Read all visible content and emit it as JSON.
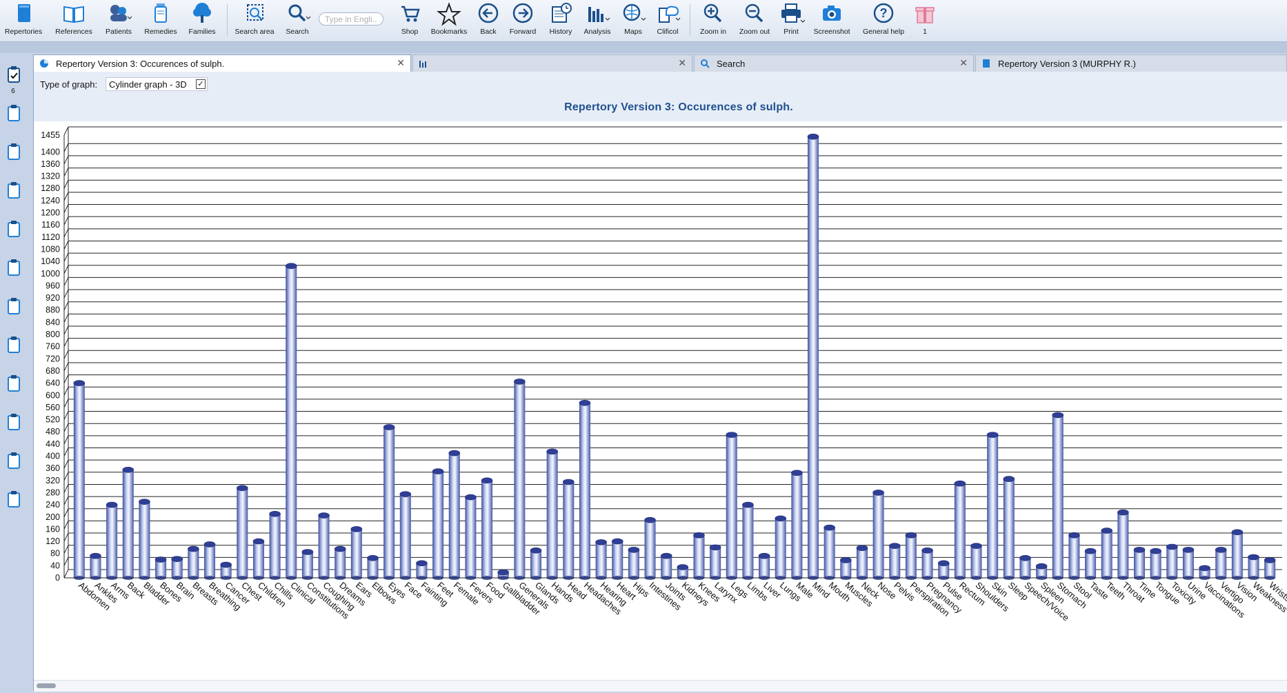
{
  "toolbar": {
    "repertories": "Repertories",
    "references": "References",
    "patients": "Patients",
    "remedies": "Remedies",
    "families": "Families",
    "search_area": "Search area",
    "search": "Search",
    "search_placeholder": "Type in Engli...",
    "shop": "Shop",
    "bookmarks": "Bookmarks",
    "back": "Back",
    "forward": "Forward",
    "history": "History",
    "analysis": "Analysis",
    "maps": "Maps",
    "clificol": "Clificol",
    "zoom_in": "Zoom in",
    "zoom_out": "Zoom out",
    "print": "Print",
    "screenshot": "Screenshot",
    "general_help": "General help",
    "gift_count": "1"
  },
  "sidebar": {
    "clipboard_count": "6"
  },
  "tabs": [
    {
      "label": "Repertory Version 3: Occurences of sulph."
    },
    {
      "label": ""
    },
    {
      "label": "Search"
    },
    {
      "label": "Repertory Version 3 (MURPHY R.)"
    }
  ],
  "panel": {
    "graph_type_label": "Type of graph:",
    "graph_type_value": "Cylinder graph - 3D"
  },
  "chart_data": {
    "type": "bar",
    "title": "Repertory Version 3: Occurences of sulph.",
    "xlabel": "",
    "ylabel": "",
    "ylim": [
      0,
      1455
    ],
    "yticks": [
      0,
      40,
      80,
      120,
      160,
      200,
      240,
      280,
      320,
      360,
      400,
      440,
      480,
      520,
      560,
      600,
      640,
      680,
      720,
      760,
      800,
      840,
      880,
      920,
      960,
      1000,
      1040,
      1080,
      1120,
      1160,
      1200,
      1240,
      1280,
      1320,
      1360,
      1400,
      1455
    ],
    "grid": true,
    "categories": [
      "Abdomen",
      "Ankles",
      "Arms",
      "Back",
      "Bladder",
      "Bones",
      "Brain",
      "Breasts",
      "Breathing",
      "Cancer",
      "Chest",
      "Children",
      "Chills",
      "Clinical",
      "Constitutions",
      "Coughing",
      "Dreams",
      "Ears",
      "Elbows",
      "Eyes",
      "Face",
      "Fainting",
      "Feet",
      "Female",
      "Fevers",
      "Food",
      "Gallbladder",
      "Generals",
      "Glands",
      "Hands",
      "Head",
      "Headaches",
      "Hearing",
      "Heart",
      "Hips",
      "Intestines",
      "Joints",
      "Kidneys",
      "Knees",
      "Larynx",
      "Legs",
      "Limbs",
      "Liver",
      "Lungs",
      "Male",
      "Mind",
      "Mouth",
      "Muscles",
      "Neck",
      "Nose",
      "Pelvis",
      "Perspiration",
      "Pregnancy",
      "Pulse",
      "Rectum",
      "Shoulders",
      "Skin",
      "Sleep",
      "Speech/Voice",
      "Spleen",
      "Stomach",
      "Stool",
      "Taste",
      "Teeth",
      "Throat",
      "Time",
      "Tongue",
      "Toxicity",
      "Urine",
      "Vaccinations",
      "Vertigo",
      "Vision",
      "Weakness",
      "Wrists"
    ],
    "values": [
      640,
      72,
      240,
      355,
      250,
      60,
      62,
      95,
      110,
      43,
      295,
      120,
      210,
      1025,
      85,
      205,
      95,
      160,
      65,
      495,
      275,
      48,
      350,
      410,
      265,
      320,
      18,
      645,
      90,
      415,
      315,
      575,
      117,
      120,
      92,
      190,
      72,
      35,
      140,
      100,
      470,
      240,
      72,
      195,
      345,
      1450,
      165,
      58,
      98,
      280,
      105,
      140,
      90,
      48,
      310,
      105,
      470,
      325,
      65,
      38,
      535,
      140,
      88,
      155,
      215,
      92,
      88,
      102,
      92,
      32,
      92,
      150,
      68,
      58
    ]
  }
}
